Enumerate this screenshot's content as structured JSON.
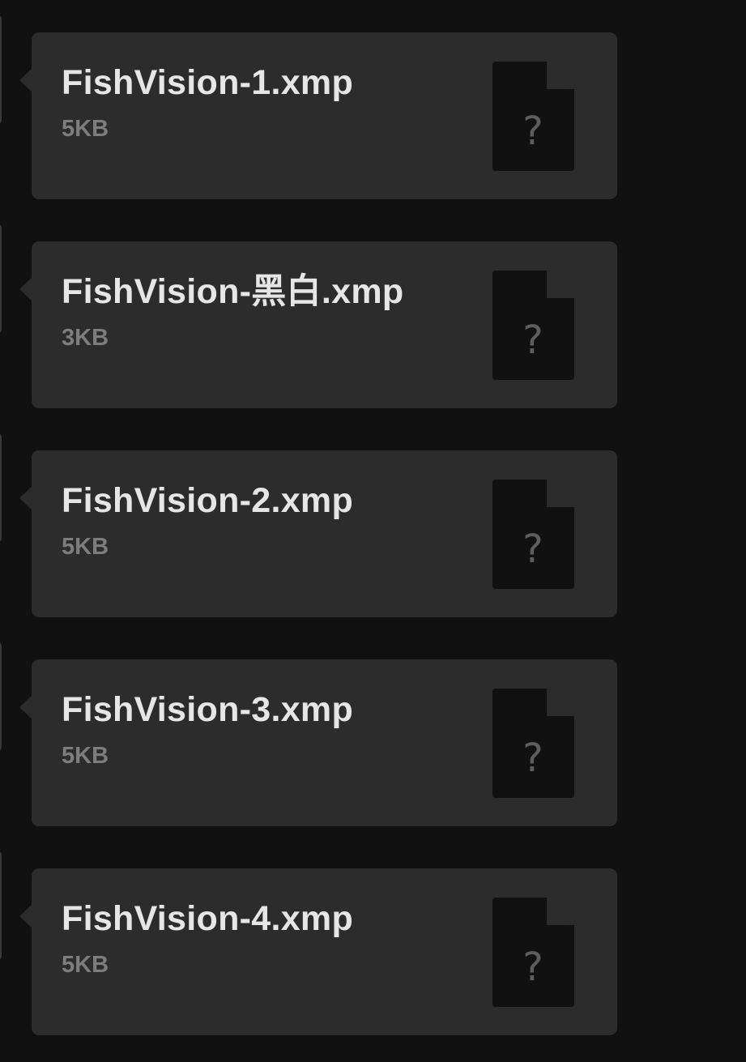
{
  "messages": [
    {
      "file_name": "FishVision-1.xmp",
      "file_size": "5KB",
      "icon": "unknown-file-icon",
      "icon_glyph": "?"
    },
    {
      "file_name": "FishVision-黑白.xmp",
      "file_size": "3KB",
      "icon": "unknown-file-icon",
      "icon_glyph": "?"
    },
    {
      "file_name": "FishVision-2.xmp",
      "file_size": "5KB",
      "icon": "unknown-file-icon",
      "icon_glyph": "?"
    },
    {
      "file_name": "FishVision-3.xmp",
      "file_size": "5KB",
      "icon": "unknown-file-icon",
      "icon_glyph": "?"
    },
    {
      "file_name": "FishVision-4.xmp",
      "file_size": "5KB",
      "icon": "unknown-file-icon",
      "icon_glyph": "?"
    }
  ],
  "colors": {
    "background": "#111111",
    "bubble": "#2c2c2c",
    "file_name_text": "#e6e6e6",
    "file_size_text": "#7d7d7d",
    "file_icon_body": "#111111",
    "file_icon_fold": "#2c2c2c",
    "file_icon_glyph": "#5e5e5e"
  }
}
